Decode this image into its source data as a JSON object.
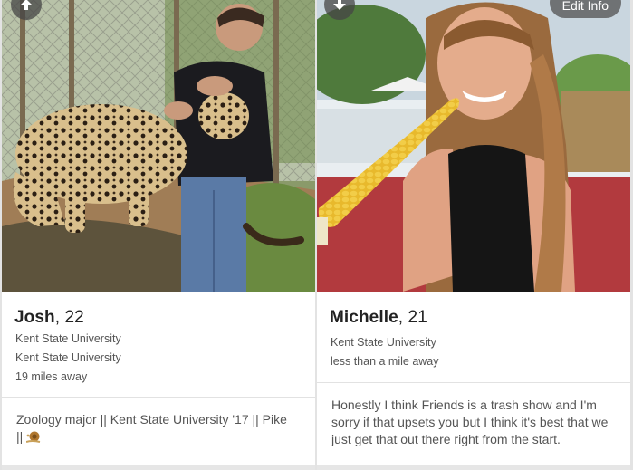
{
  "profiles": [
    {
      "name": "Josh",
      "age_text": ", 22",
      "details": [
        "Kent State University",
        "Kent State University",
        "19 miles away"
      ],
      "bio": "Zoology major || Kent State University '17 || Pike ||",
      "bio_emoji": "snail-icon",
      "nav_icon": "arrow-up-icon"
    },
    {
      "name": "Michelle",
      "age_text": ", 21",
      "details": [
        "Kent State University",
        "less than a mile away"
      ],
      "bio": "Honestly I think Friends is a trash show and I'm sorry if that upsets you but I think it's best that we just get that out there right from the start.",
      "nav_icon": "arrow-down-icon",
      "edit_label": "Edit Info"
    }
  ],
  "colors": {
    "name_text": "#222222",
    "meta_text": "#555555",
    "divider": "#e2e2e2"
  }
}
